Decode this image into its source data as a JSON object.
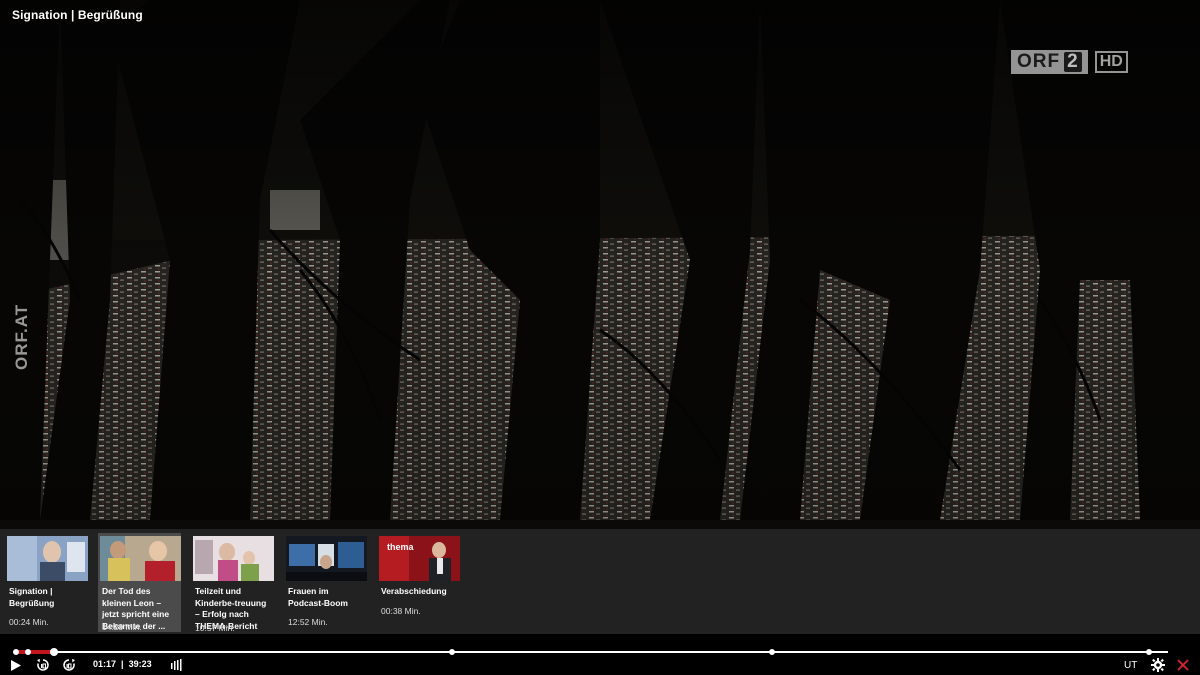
{
  "window": {
    "title": "Signation | Begrüßung"
  },
  "overlay": {
    "logo_orf": "ORF",
    "logo_two": "2",
    "logo_hd": "HD",
    "watermark": "ORF.AT"
  },
  "chapters": [
    {
      "title": "Signation | Begrüßung",
      "duration": "00:24 Min.",
      "active": false
    },
    {
      "title": "Der Tod des kleinen Leon – jetzt spricht eine Bekannte der ...",
      "duration": "14:29 Min.",
      "active": true
    },
    {
      "title": "Teilzeit und Kinderbe-treuung – Erfolg nach THEMA-Bericht",
      "duration": "10:57 Min.",
      "active": false
    },
    {
      "title": "Frauen im Podcast-Boom",
      "duration": "12:52 Min.",
      "active": false
    },
    {
      "title": "Verabschiedung",
      "duration": "00:38 Min.",
      "active": false
    }
  ],
  "thumb_texts": {
    "thema_logo": "thema"
  },
  "player": {
    "current_time": "01:17",
    "separator": "|",
    "total_time": "39:23",
    "progress_fraction": 0.0326,
    "chapter_marker_fractions": [
      0.0,
      0.0102,
      0.3782,
      0.656,
      0.9839
    ],
    "subtitles_label": "UT",
    "icons": [
      "play-icon",
      "rewind-icon",
      "forward-icon",
      "audio-levels-icon",
      "settings-icon",
      "close-icon"
    ],
    "accent_color": "#c1161d",
    "close_color": "#d9262c"
  }
}
